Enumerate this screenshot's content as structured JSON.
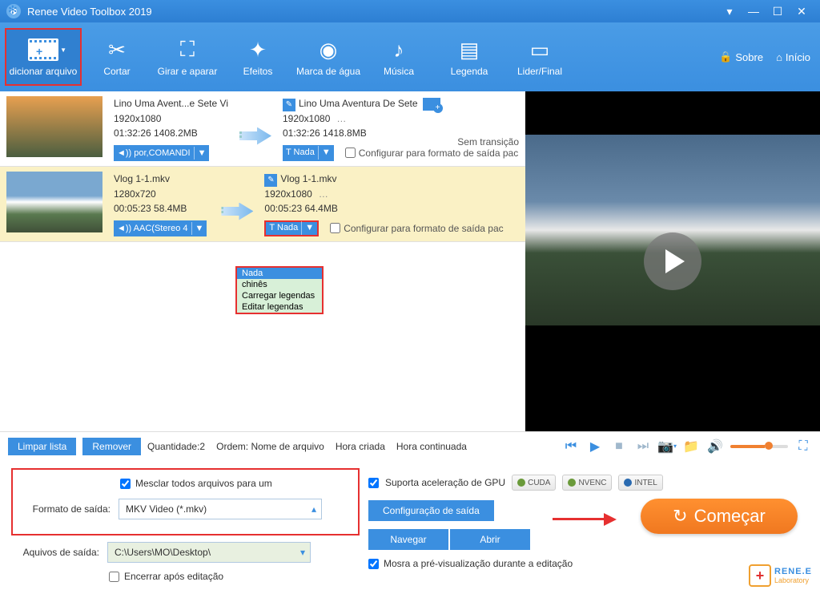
{
  "title": "Renee Video Toolbox 2019",
  "toolbar": {
    "add": "dicionar arquivo",
    "cut": "Cortar",
    "rotate": "Girar e aparar",
    "effects": "Efeitos",
    "watermark": "Marca de água",
    "music": "Música",
    "subtitle": "Legenda",
    "leader": "Lider/Final",
    "about": "Sobre",
    "home": "Início"
  },
  "rows": [
    {
      "name": "Lino Uma Avent...e Sete Vi",
      "res": "1920x1080",
      "dur": "01:32:26 1408.2MB",
      "audio": "◄)) por,COMANDI",
      "sub": "T  Nada",
      "outname": "Lino Uma Aventura De Sete",
      "outres": "1920x1080",
      "outdur": "01:32:26 1418.8MB",
      "trans": "Sem transição",
      "config": "Configurar para formato de saída pac"
    },
    {
      "name": "Vlog 1-1.mkv",
      "res": "1280x720",
      "dur": "00:05:23 58.4MB",
      "audio": "◄)) AAC(Stereo 4",
      "sub": "T  Nada",
      "outname": "Vlog 1-1.mkv",
      "outres": "1920x1080",
      "outdur": "00:05:23 64.4MB",
      "config": "Configurar para formato de saída pac"
    }
  ],
  "dropdown": [
    "Nada",
    "chinês",
    "Carregar legendas",
    "Editar legendas"
  ],
  "controls": {
    "clear": "Limpar lista",
    "remove": "Remover",
    "qty": "Quantidade:2",
    "order": "Ordem: Nome de arquivo",
    "created": "Hora criada",
    "continued": "Hora continuada"
  },
  "bottom": {
    "merge": "Mesclar todos arquivos para um",
    "format_label": "Formato de saída:",
    "format_value": "MKV Video (*.mkv)",
    "output_label": "Aquivos de saída:",
    "output_path": "C:\\Users\\MO\\Desktop\\",
    "close_after": "Encerrar após editação",
    "gpu_label": "Suporta aceleração de GPU",
    "gpu_badges": [
      "CUDA",
      "NVENC",
      "INTEL"
    ],
    "config_out": "Configuração de saída",
    "browse": "Navegar",
    "open": "Abrir",
    "preview_chk": "Mosra a pré-visualização durante a editação",
    "start": "Começar",
    "brand1": "RENE.E",
    "brand2": "Laboratory"
  }
}
